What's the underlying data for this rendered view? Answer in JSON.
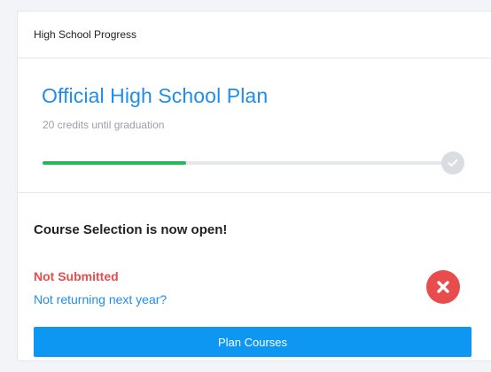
{
  "card": {
    "header": "High School Progress"
  },
  "plan": {
    "title": "Official High School Plan",
    "subtitle": "20 credits until graduation",
    "progress_fraction": 0.35,
    "progress_color": "#23b85a",
    "end_icon": "check-icon"
  },
  "selection": {
    "title": "Course Selection is now open!",
    "status": "Not Submitted",
    "status_color": "#e84c4c",
    "return_link": "Not returning next year?",
    "status_icon": "x-circle-icon",
    "button_label": "Plan Courses",
    "button_color": "#0d96f2"
  }
}
